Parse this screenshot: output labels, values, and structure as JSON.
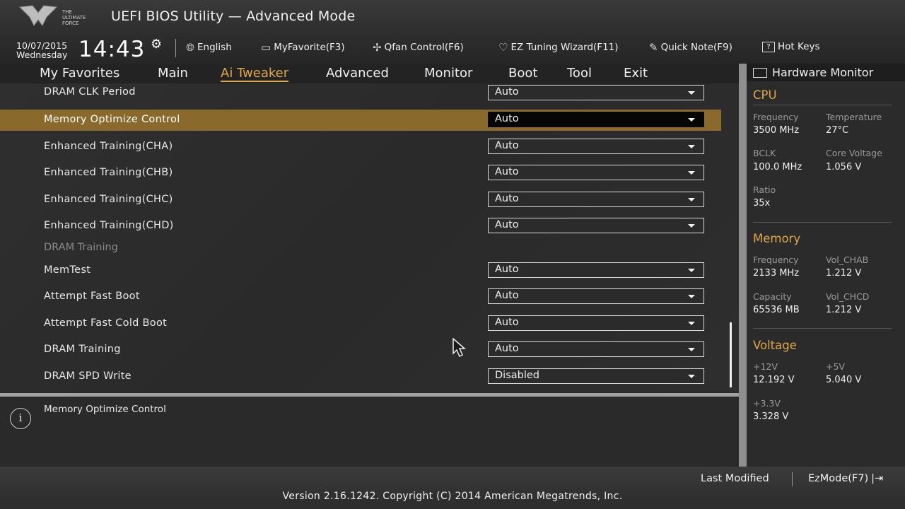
{
  "header": {
    "title": "UEFI BIOS Utility — Advanced Mode",
    "logo_text_lines": [
      "THE",
      "ULTIMATE",
      "FORCE"
    ],
    "date": "10/07/2015",
    "weekday": "Wednesday",
    "time": "14:43",
    "toolbar": {
      "language": "English",
      "myfavorite": "MyFavorite(F3)",
      "qfan": "Qfan Control(F6)",
      "ez_tuning": "EZ Tuning Wizard(F11)",
      "quick_note": "Quick Note(F9)",
      "hot_keys": "Hot Keys"
    }
  },
  "tabs": [
    {
      "label": "My Favorites"
    },
    {
      "label": "Main"
    },
    {
      "label": "Ai Tweaker",
      "active": true
    },
    {
      "label": "Advanced"
    },
    {
      "label": "Monitor"
    },
    {
      "label": "Boot"
    },
    {
      "label": "Tool"
    },
    {
      "label": "Exit"
    }
  ],
  "settings": {
    "rows": [
      {
        "label": "DRAM CLK Period",
        "value": "Auto"
      },
      {
        "label": "Memory Optimize Control",
        "value": "Auto",
        "selected": true
      },
      {
        "label": "Enhanced Training(CHA)",
        "value": "Auto"
      },
      {
        "label": "Enhanced Training(CHB)",
        "value": "Auto"
      },
      {
        "label": "Enhanced Training(CHC)",
        "value": "Auto"
      },
      {
        "label": "Enhanced Training(CHD)",
        "value": "Auto"
      },
      {
        "label": "MemTest",
        "value": "Auto"
      },
      {
        "label": "Attempt Fast Boot",
        "value": "Auto"
      },
      {
        "label": "Attempt Fast Cold Boot",
        "value": "Auto"
      },
      {
        "label": "DRAM Training",
        "value": "Auto"
      },
      {
        "label": "DRAM SPD Write",
        "value": "Disabled"
      }
    ],
    "subheading": "DRAM Training"
  },
  "help": {
    "text": "Memory Optimize Control"
  },
  "hardware_monitor": {
    "title": "Hardware Monitor",
    "cpu": {
      "heading": "CPU",
      "frequency_label": "Frequency",
      "frequency": "3500 MHz",
      "temperature_label": "Temperature",
      "temperature": "27°C",
      "bclk_label": "BCLK",
      "bclk": "100.0 MHz",
      "core_voltage_label": "Core Voltage",
      "core_voltage": "1.056 V",
      "ratio_label": "Ratio",
      "ratio": "35x"
    },
    "memory": {
      "heading": "Memory",
      "frequency_label": "Frequency",
      "frequency": "2133 MHz",
      "vol_chab_label": "Vol_CHAB",
      "vol_chab": "1.212 V",
      "capacity_label": "Capacity",
      "capacity": "65536 MB",
      "vol_chcd_label": "Vol_CHCD",
      "vol_chcd": "1.212 V"
    },
    "voltage": {
      "heading": "Voltage",
      "v12_label": "+12V",
      "v12": "12.192 V",
      "v5_label": "+5V",
      "v5": "5.040 V",
      "v33_label": "+3.3V",
      "v33": "3.328 V"
    }
  },
  "footer": {
    "last_modified": "Last Modified",
    "ezmode": "EzMode(F7)",
    "version": "Version 2.16.1242. Copyright (C) 2014 American Megatrends, Inc."
  },
  "colors": {
    "accent": "#e0a74a",
    "selected_row": "#8a6a2c"
  }
}
